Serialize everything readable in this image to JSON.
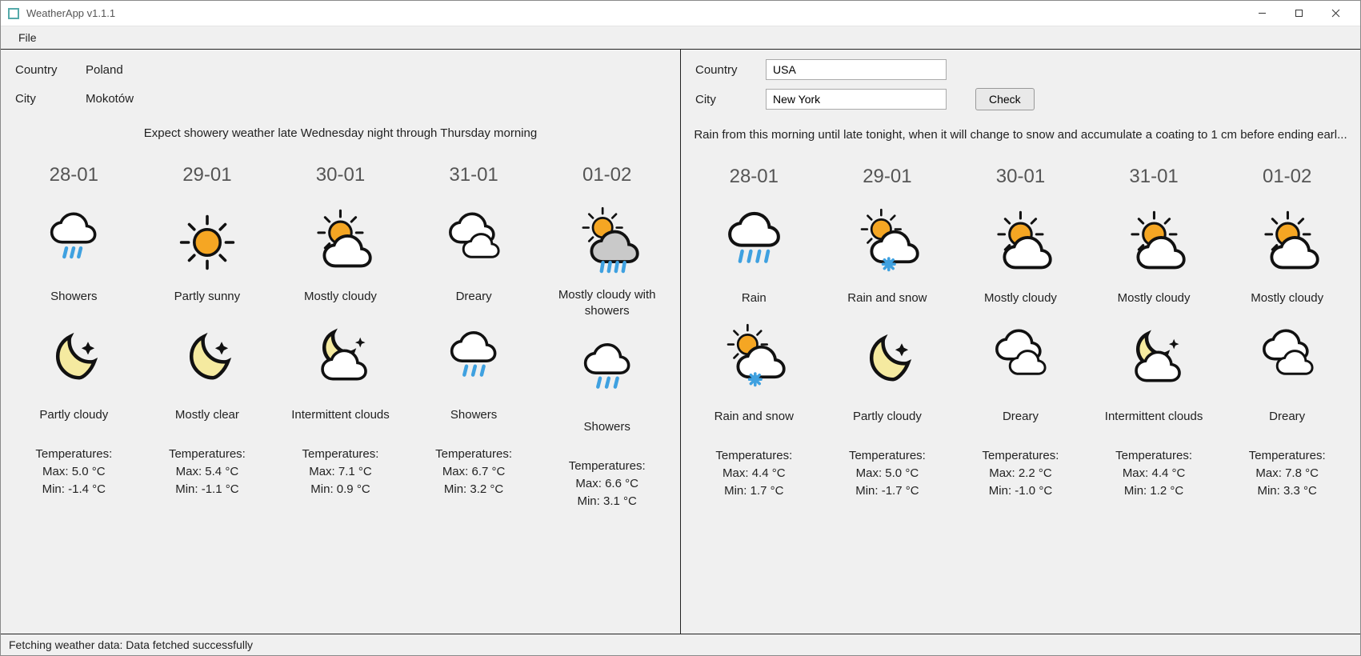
{
  "window": {
    "title": "WeatherApp v1.1.1"
  },
  "menu": {
    "file": "File"
  },
  "left": {
    "country_label": "Country",
    "country_value": "Poland",
    "city_label": "City",
    "city_value": "Mokotów",
    "summary": "Expect showery weather late Wednesday night through Thursday morning",
    "temps_heading": "Temperatures:",
    "days": [
      {
        "date": "28-01",
        "day_icon": "showers",
        "day_cond": "Showers",
        "night_icon": "moon-clear",
        "night_cond": "Partly cloudy",
        "max": "Max: 5.0 °C",
        "min": "Min: -1.4 °C"
      },
      {
        "date": "29-01",
        "day_icon": "sunny",
        "day_cond": "Partly sunny",
        "night_icon": "moon-clear",
        "night_cond": "Mostly clear",
        "max": "Max: 5.4 °C",
        "min": "Min: -1.1 °C"
      },
      {
        "date": "30-01",
        "day_icon": "partly-cloudy",
        "day_cond": "Mostly cloudy",
        "night_icon": "moon-cloud",
        "night_cond": "Intermittent clouds",
        "max": "Max: 7.1 °C",
        "min": "Min: 0.9 °C"
      },
      {
        "date": "31-01",
        "day_icon": "dreary",
        "day_cond": "Dreary",
        "night_icon": "cloud-rain",
        "night_cond": "Showers",
        "max": "Max: 6.7 °C",
        "min": "Min: 3.2 °C"
      },
      {
        "date": "01-02",
        "day_icon": "partly-showers",
        "day_cond": "Mostly cloudy with showers",
        "night_icon": "cloud-rain",
        "night_cond": "Showers",
        "max": "Max: 6.6 °C",
        "min": "Min: 3.1 °C"
      }
    ]
  },
  "right": {
    "country_label": "Country",
    "country_value": "USA",
    "city_label": "City",
    "city_value": "New York",
    "check_label": "Check",
    "summary": "Rain from this morning until late tonight, when it will change to snow and accumulate a coating to 1 cm before ending earl...",
    "temps_heading": "Temperatures:",
    "days": [
      {
        "date": "28-01",
        "day_icon": "rain",
        "day_cond": "Rain",
        "night_icon": "sun-cloud-snow",
        "night_cond": "Rain and snow",
        "max": "Max: 4.4 °C",
        "min": "Min: 1.7 °C"
      },
      {
        "date": "29-01",
        "day_icon": "sun-cloud-snow",
        "day_cond": "Rain and snow",
        "night_icon": "moon-clear",
        "night_cond": "Partly cloudy",
        "max": "Max: 5.0 °C",
        "min": "Min: -1.7 °C"
      },
      {
        "date": "30-01",
        "day_icon": "partly-cloudy",
        "day_cond": "Mostly cloudy",
        "night_icon": "dreary",
        "night_cond": "Dreary",
        "max": "Max: 2.2 °C",
        "min": "Min: -1.0 °C"
      },
      {
        "date": "31-01",
        "day_icon": "partly-cloudy",
        "day_cond": "Mostly cloudy",
        "night_icon": "moon-cloud",
        "night_cond": "Intermittent clouds",
        "max": "Max: 4.4 °C",
        "min": "Min: 1.2 °C"
      },
      {
        "date": "01-02",
        "day_icon": "partly-cloudy",
        "day_cond": "Mostly cloudy",
        "night_icon": "dreary",
        "night_cond": "Dreary",
        "max": "Max: 7.8 °C",
        "min": "Min: 3.3 °C"
      }
    ]
  },
  "status": "Fetching weather data: Data fetched successfully"
}
